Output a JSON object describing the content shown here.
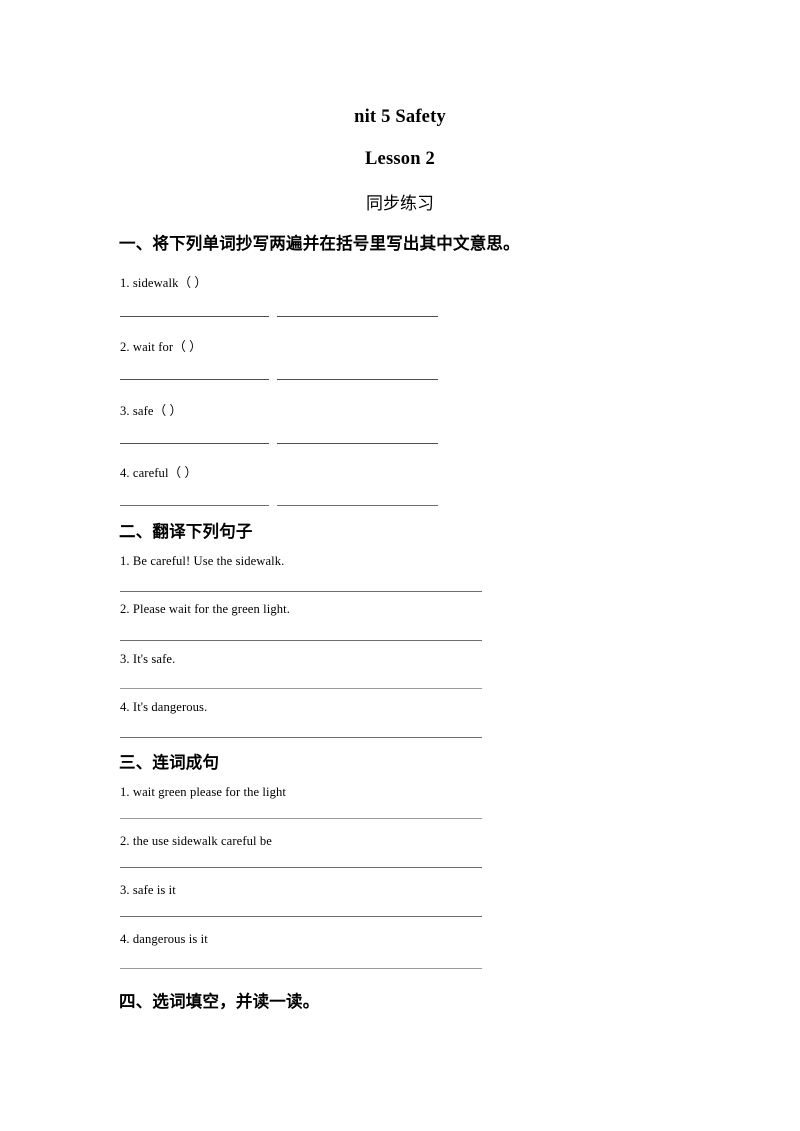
{
  "document": {
    "title_line_1": "nit 5 Safety",
    "title_line_2": "Lesson 2",
    "title_line_3": "同步练习"
  },
  "sections": [
    {
      "heading": "一、将下列单词抄写两遍并在括号里写出其中文意思。",
      "items": [
        "1. sidewalk（        ）",
        "2. wait for（        ）",
        "3. safe（        ）",
        "4. careful（        ）"
      ]
    },
    {
      "heading": "二、翻译下列句子",
      "items": [
        "1. Be careful! Use the sidewalk.",
        "2. Please wait for the green light.",
        "3. It's safe.",
        "4. It's dangerous."
      ]
    },
    {
      "heading": "三、连词成句",
      "items": [
        "1. wait green please for the light",
        "2. the use sidewalk careful be",
        "3. safe is it",
        "4. dangerous is it"
      ]
    },
    {
      "heading": "四、选词填空，并读一读。",
      "items": []
    }
  ],
  "colors": {
    "text": "#000000",
    "rule_dark": "#4c4c4c",
    "rule_medium": "#6e6e6e",
    "rule_light": "#9a9a9a",
    "page_background": "#ffffff"
  }
}
